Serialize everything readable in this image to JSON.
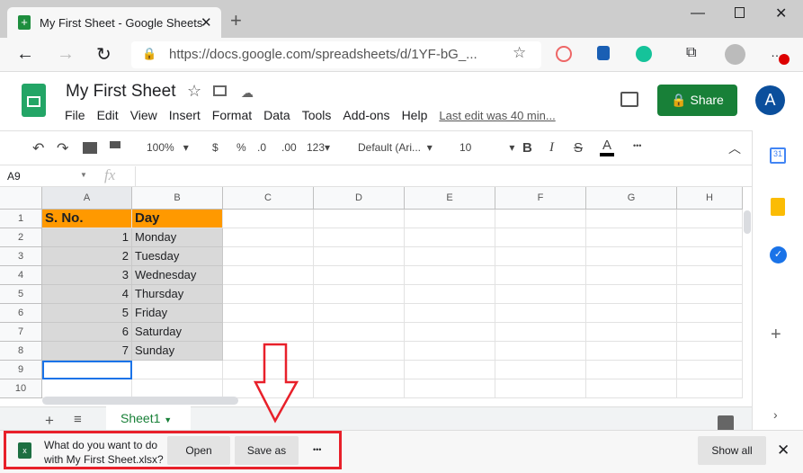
{
  "browser": {
    "tab_title": "My First Sheet - Google Sheets",
    "url": "https://docs.google.com/spreadsheets/d/1YF-bG_..."
  },
  "doc": {
    "title": "My First Sheet",
    "menu": [
      "File",
      "Edit",
      "View",
      "Insert",
      "Format",
      "Data",
      "Tools",
      "Add-ons",
      "Help"
    ],
    "last_edit": "Last edit was 40 min...",
    "share": "Share",
    "avatar": "A"
  },
  "toolbar": {
    "zoom": "100%",
    "currency": "$",
    "percent": "%",
    "dec_less": ".0",
    "dec_more": ".00",
    "format": "123",
    "font": "Default (Ari...",
    "size": "10",
    "bold": "B",
    "italic": "I",
    "strike": "S",
    "color": "A",
    "more": "•••"
  },
  "formula": {
    "cell_ref": "A9",
    "fx": "fx",
    "value": ""
  },
  "columns": [
    "A",
    "B",
    "C",
    "D",
    "E",
    "F",
    "G",
    "H"
  ],
  "rows": [
    [
      "S. No.",
      "Day"
    ],
    [
      "1",
      "Monday"
    ],
    [
      "2",
      "Tuesday"
    ],
    [
      "3",
      "Wednesday"
    ],
    [
      "4",
      "Thursday"
    ],
    [
      "5",
      "Friday"
    ],
    [
      "6",
      "Saturday"
    ],
    [
      "7",
      "Sunday"
    ],
    [
      "",
      ""
    ],
    [
      "",
      ""
    ]
  ],
  "colors": {
    "header_fill": "#ff9900",
    "selected_fill": "#d9d9d9",
    "share": "#188038",
    "annotation": "#e8202a"
  },
  "sheet_tab": "Sheet1",
  "download": {
    "message_line1": "What do you want to do",
    "message_line2": "with My First Sheet.xlsx?",
    "open": "Open",
    "save_as": "Save as",
    "more": "•••",
    "show_all": "Show all"
  }
}
